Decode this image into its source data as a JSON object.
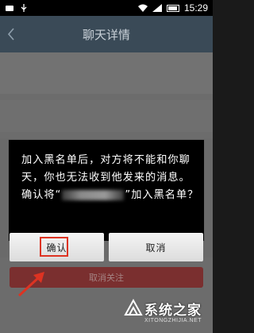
{
  "statusbar": {
    "time": "15:29"
  },
  "titlebar": {
    "title": "聊天详情"
  },
  "background": {
    "cancel_follow": "取消关注"
  },
  "dialog": {
    "line1": "加入黑名单后，对方将不能和你聊天，你也无法收到他发来的消息。",
    "line2_before": "确认将“",
    "line2_after": "”加入黑名单？",
    "confirm_label": "确认",
    "cancel_label": "取消"
  },
  "watermark": {
    "brand": "系统之家",
    "url": "XITONGZHIJIA.NET"
  },
  "colors": {
    "titlebar": "#3a4a57",
    "dialog_bg": "#000000",
    "highlight": "#dd3322"
  }
}
